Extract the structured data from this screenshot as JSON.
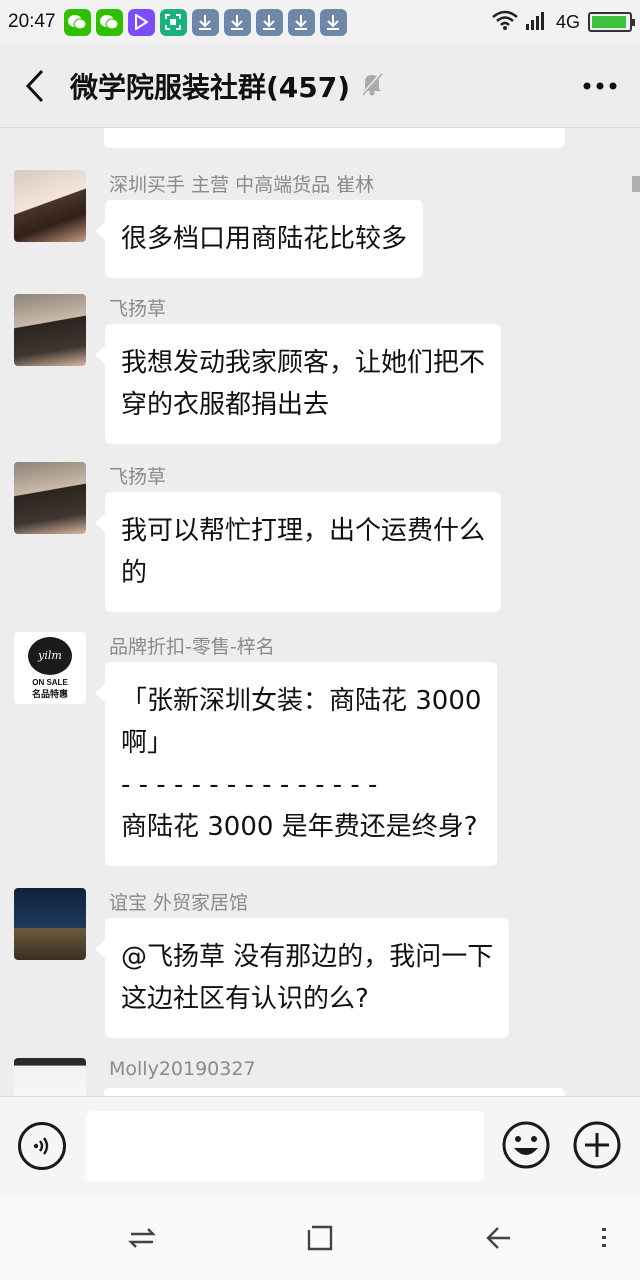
{
  "status_bar": {
    "time": "20:47",
    "network": "4G",
    "battery_level": 0.95,
    "notification_icons": [
      "wechat-icon",
      "wechat-icon",
      "video-icon",
      "scan-icon",
      "download-icon",
      "download-icon",
      "download-icon",
      "download-icon",
      "download-icon"
    ]
  },
  "header": {
    "title": "微学院服装社群(457)",
    "muted": true
  },
  "messages": [
    {
      "sender": "深圳买手  主营 中高端货品  崔林",
      "lines": [
        "很多档口用商陆花比较多"
      ],
      "avatar": "girl-photo"
    },
    {
      "sender": "飞扬草",
      "lines": [
        "我想发动我家顾客，让她们把不",
        "穿的衣服都捐出去"
      ],
      "avatar": "feiyangcao-photo"
    },
    {
      "sender": "飞扬草",
      "lines": [
        "我可以帮忙打理，出个运费什么",
        "的"
      ],
      "avatar": "feiyangcao-photo"
    },
    {
      "sender": "品牌折扣-零售-梓名",
      "lines": [
        "「张新深圳女装：商陆花 3000",
        "啊」",
        "- - - - - - - - - - - - - - -",
        "商陆花 3000 是年费还是终身?"
      ],
      "avatar": "brand-logo",
      "avatar_text": {
        "script": "yilm",
        "label": "ON SALE",
        "sub": "名品特惠"
      }
    },
    {
      "sender": "谊宝 外贸家居馆",
      "lines": [
        "@飞扬草  没有那边的，我问一下",
        "这边社区有认识的么?"
      ],
      "avatar": "night-scene"
    },
    {
      "sender": "Molly20190327",
      "lines": [],
      "avatar": "molly-photo"
    }
  ],
  "input": {
    "value": "",
    "placeholder": ""
  },
  "colors": {
    "background": "#ededed",
    "bubble": "#ffffff",
    "sender_name": "#8a8a8a",
    "wechat_green": "#2dc100"
  }
}
